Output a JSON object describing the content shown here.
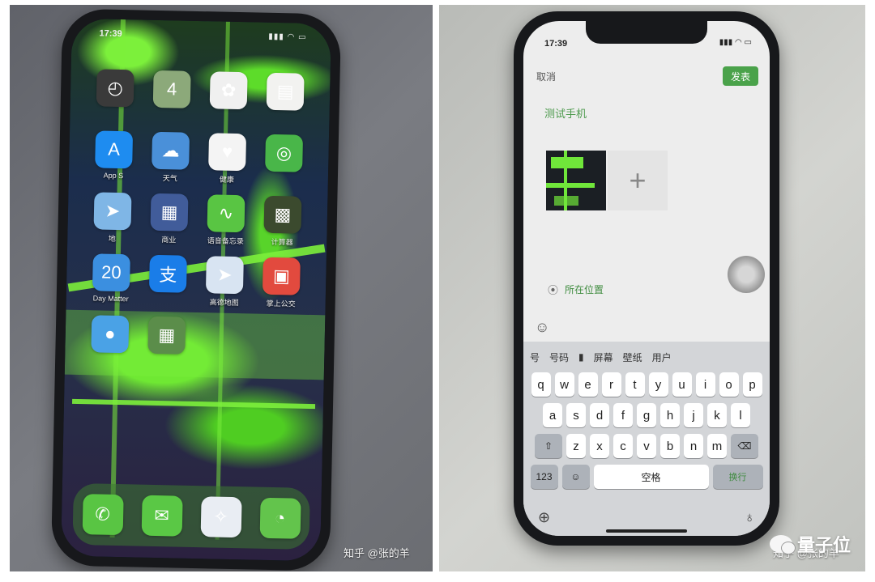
{
  "left_photo": {
    "status_time": "17:39",
    "apps": [
      {
        "label": "",
        "icon": "clock-icon",
        "glyph": "◴",
        "color": "#3a3a3a"
      },
      {
        "label": "",
        "icon": "calendar-icon",
        "glyph": "4",
        "color": "#8ca97a"
      },
      {
        "label": "",
        "icon": "photos-icon",
        "glyph": "✿",
        "color": "#f0f0f0"
      },
      {
        "label": "",
        "icon": "notes-icon",
        "glyph": "▤",
        "color": "#f2f2f0"
      },
      {
        "label": "App S",
        "icon": "app-store-icon",
        "glyph": "A",
        "color": "#1e8cf0"
      },
      {
        "label": "天气",
        "icon": "weather-icon",
        "glyph": "☁",
        "color": "#4a90d9"
      },
      {
        "label": "健康",
        "icon": "health-icon",
        "glyph": "♥",
        "color": "#f4f4f4"
      },
      {
        "label": "",
        "icon": "find-my-icon",
        "glyph": "◎",
        "color": "#49b649"
      },
      {
        "label": "地",
        "icon": "maps-icon",
        "glyph": "➤",
        "color": "#7fb6e6"
      },
      {
        "label": "商业",
        "icon": "business-folder-icon",
        "glyph": "▦",
        "color": "#415c9a"
      },
      {
        "label": "语音备忘录",
        "icon": "voice-memos-icon",
        "glyph": "∿",
        "color": "#59c543"
      },
      {
        "label": "计算器",
        "icon": "calculator-icon",
        "glyph": "▩",
        "color": "#3b4a2e"
      },
      {
        "label": "Day Matter",
        "icon": "days-matter-icon",
        "glyph": "20",
        "color": "#3b8fe0"
      },
      {
        "label": "",
        "icon": "alipay-icon",
        "glyph": "支",
        "color": "#1a7de8"
      },
      {
        "label": "高德地图",
        "icon": "amap-icon",
        "glyph": "➤",
        "color": "#d8e4f2"
      },
      {
        "label": "掌上公交",
        "icon": "bus-app-icon",
        "glyph": "▣",
        "color": "#e24a3e"
      },
      {
        "label": "",
        "icon": "apple-store-icon",
        "glyph": "●",
        "color": "#4aa2e6"
      },
      {
        "label": "",
        "icon": "folder-icon",
        "glyph": "▦",
        "color": "#5b8d4a"
      }
    ],
    "dock": [
      {
        "icon": "phone-icon",
        "glyph": "✆",
        "color": "#59c543"
      },
      {
        "icon": "messages-icon",
        "glyph": "✉",
        "color": "#5ac845"
      },
      {
        "icon": "safari-icon",
        "glyph": "✧",
        "color": "#e9edf3"
      },
      {
        "icon": "wechat-icon",
        "glyph": "◔",
        "color": "#63c44c"
      }
    ],
    "watermark": "知乎 @张的羊"
  },
  "right_photo": {
    "status_time": "17:39",
    "cancel_label": "取消",
    "post_label": "发表",
    "post_text": "测试手机",
    "add_glyph": "+",
    "location_label": "所在位置",
    "candidates": [
      "号",
      "号码",
      "▮",
      "屏幕",
      "壁纸",
      "用户"
    ],
    "keyboard_rows": [
      [
        "q",
        "w",
        "e",
        "r",
        "t",
        "y",
        "u",
        "i",
        "o",
        "p"
      ],
      [
        "a",
        "s",
        "d",
        "f",
        "g",
        "h",
        "j",
        "k",
        "l"
      ],
      [
        "z",
        "x",
        "c",
        "v",
        "b",
        "n",
        "m"
      ]
    ],
    "space_label": "空格",
    "return_label": "换行",
    "watermark": "知乎 @张的羊",
    "logo_text": "量子位"
  }
}
